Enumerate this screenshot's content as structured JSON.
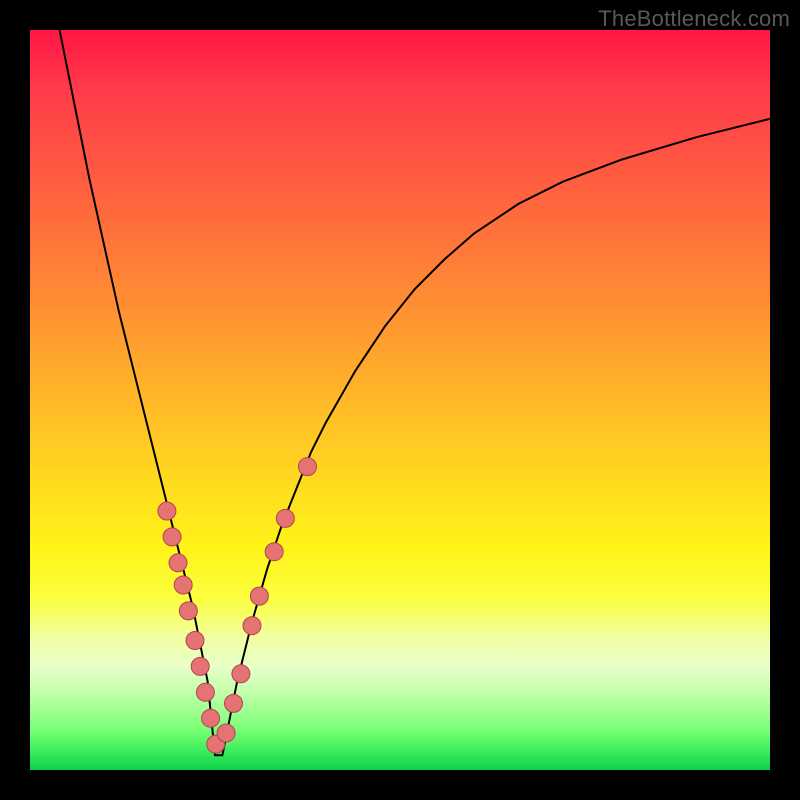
{
  "watermark": "TheBottleneck.com",
  "icons": {
    "marker": "marker-dot-icon"
  },
  "chart_data": {
    "type": "line",
    "title": "",
    "xlabel": "",
    "ylabel": "",
    "xlim": [
      0,
      100
    ],
    "ylim": [
      0,
      100
    ],
    "description": "V-shaped bottleneck curve over red-to-green vertical gradient background. Curve dips from top-left to near bottom at x≈25 then rises with decreasing slope toward upper-right.",
    "series": [
      {
        "name": "bottleneck-curve",
        "x": [
          4,
          6,
          8,
          10,
          12,
          14,
          16,
          18,
          20,
          22,
          24,
          25,
          26,
          28,
          30,
          32,
          34,
          36,
          38,
          40,
          44,
          48,
          52,
          56,
          60,
          66,
          72,
          80,
          90,
          100
        ],
        "values": [
          100,
          90,
          80,
          71,
          62,
          54,
          46,
          38,
          30,
          22,
          12,
          2,
          2,
          12,
          20,
          27,
          33,
          38,
          43,
          47,
          54,
          60,
          65,
          69,
          72.5,
          76.5,
          79.5,
          82.5,
          85.5,
          88
        ]
      },
      {
        "name": "markers-left",
        "type": "scatter",
        "x": [
          18.5,
          19.2,
          20,
          20.7,
          21.4,
          22.3,
          23,
          23.7,
          24.4,
          25.1
        ],
        "values": [
          35,
          31.5,
          28,
          25,
          21.5,
          17.5,
          14,
          10.5,
          7,
          3.5
        ]
      },
      {
        "name": "markers-right",
        "type": "scatter",
        "x": [
          26.5,
          27.5,
          28.5,
          30,
          31,
          33,
          34.5,
          37.5
        ],
        "values": [
          5,
          9,
          13,
          19.5,
          23.5,
          29.5,
          34,
          41
        ]
      }
    ],
    "gradient_stops": [
      {
        "pos": 0,
        "color": "#ff1744"
      },
      {
        "pos": 0.2,
        "color": "#ff5c40"
      },
      {
        "pos": 0.45,
        "color": "#ffa82c"
      },
      {
        "pos": 0.7,
        "color": "#fff418"
      },
      {
        "pos": 0.88,
        "color": "#d8ffb8"
      },
      {
        "pos": 1.0,
        "color": "#10d048"
      }
    ]
  }
}
